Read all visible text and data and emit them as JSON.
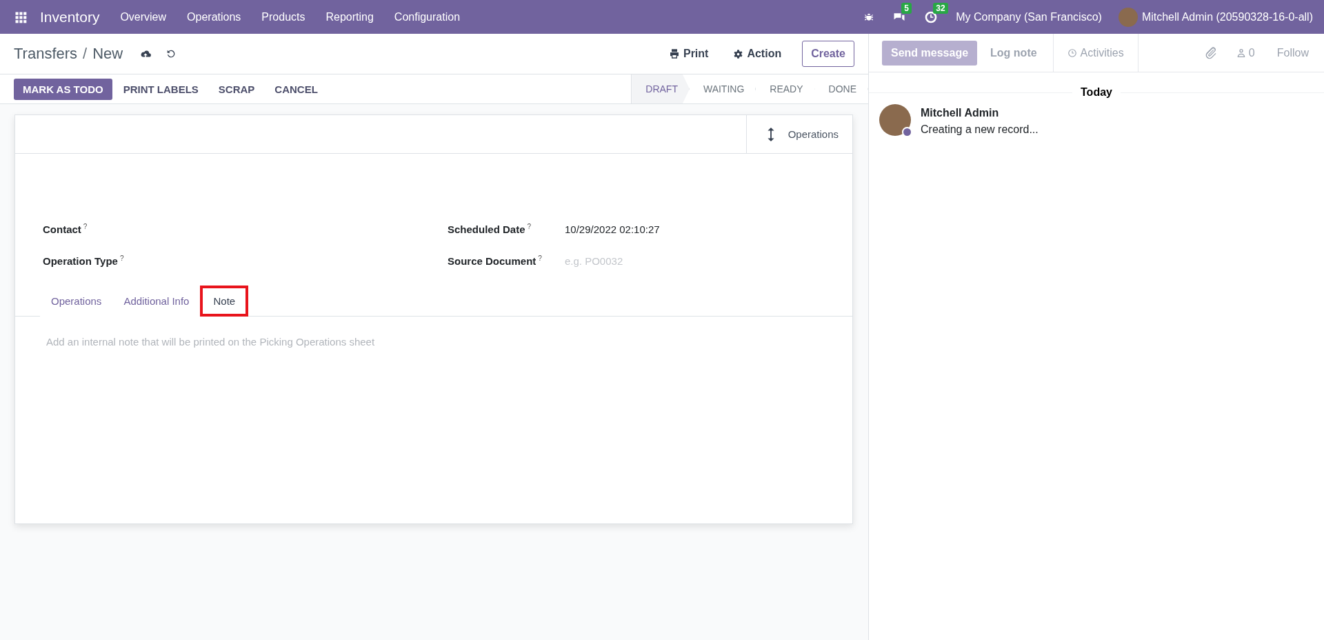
{
  "navbar": {
    "app_name": "Inventory",
    "menu": [
      "Overview",
      "Operations",
      "Products",
      "Reporting",
      "Configuration"
    ],
    "messages_count": "5",
    "activities_count": "32",
    "company": "My Company (San Francisco)",
    "user": "Mitchell Admin (20590328-16-0-all)"
  },
  "control_panel": {
    "breadcrumb": [
      "Transfers",
      "New"
    ],
    "separator": "/",
    "print": "Print",
    "action": "Action",
    "create": "Create"
  },
  "status_buttons": [
    {
      "label": "MARK AS TODO",
      "primary": true
    },
    {
      "label": "PRINT LABELS",
      "primary": false
    },
    {
      "label": "SCRAP",
      "primary": false
    },
    {
      "label": "CANCEL",
      "primary": false
    }
  ],
  "stages": [
    {
      "label": "DRAFT",
      "selected": true
    },
    {
      "label": "WAITING",
      "selected": false
    },
    {
      "label": "READY",
      "selected": false
    },
    {
      "label": "DONE",
      "selected": false
    }
  ],
  "sheet": {
    "smart_button": "Operations",
    "fields_left": [
      {
        "label": "Contact",
        "help": "?"
      },
      {
        "label": "Operation Type",
        "help": "?"
      }
    ],
    "fields_right": [
      {
        "label": "Scheduled Date",
        "help": "?",
        "value": "10/29/2022 02:10:27"
      },
      {
        "label": "Source Document",
        "help": "?",
        "placeholder": "e.g. PO0032"
      }
    ],
    "tabs": [
      {
        "label": "Operations",
        "selected": false,
        "highlighted": false
      },
      {
        "label": "Additional Info",
        "selected": false,
        "highlighted": false
      },
      {
        "label": "Note",
        "selected": true,
        "highlighted": true
      }
    ],
    "note_placeholder": "Add an internal note that will be printed on the Picking Operations sheet"
  },
  "chatter": {
    "buttons": [
      {
        "label": "Send message",
        "selected": true
      },
      {
        "label": "Log note",
        "selected": false
      }
    ],
    "activities": "Activities",
    "followers_count": "0",
    "follow": "Follow",
    "date": "Today",
    "messages": [
      {
        "author": "Mitchell Admin",
        "body": "Creating a new record..."
      }
    ]
  }
}
